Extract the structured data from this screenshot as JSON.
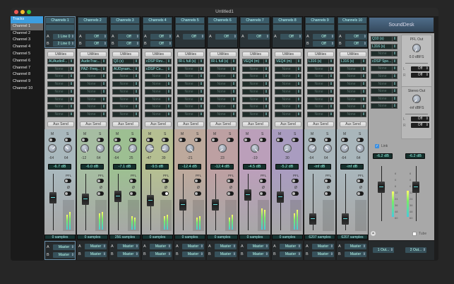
{
  "window": {
    "title": "Untitled1"
  },
  "sidebar": {
    "items": [
      "Tracks",
      "Channel 1",
      "Channel 2",
      "Channel 3",
      "Channel 4",
      "Channel 5",
      "Channel 6",
      "Channel 7",
      "Channel 8",
      "Channel 9",
      "Channel 10"
    ]
  },
  "labels": {
    "utilities": "Utilities",
    "aux_send": "Aux Send",
    "mute": "M",
    "solo": "S",
    "pfl": "PFL",
    "phase": "Ø",
    "a": "A",
    "b": "B"
  },
  "channels": [
    {
      "name": "Channels 1",
      "a": "1 Line 0",
      "b": "2 Line 0",
      "plugins": [
        "AUAudioF...",
        "None",
        "None",
        "None",
        "None",
        "None",
        "None",
        "None"
      ],
      "pan": [
        "-64",
        "64"
      ],
      "db": "-6.7 dB",
      "samples": "0 samples",
      "out_a": "Master",
      "out_b": "Master",
      "tint": "#a9b8bd",
      "fader": 0.6,
      "meter": [
        0.55,
        0.65
      ],
      "phase_on": false
    },
    {
      "name": "Channels 2",
      "a": "Off",
      "b": "Off",
      "plugins": [
        "AudioTrac...",
        "PAZ- Freq...",
        "None",
        "None",
        "None",
        "None",
        "None",
        "None"
      ],
      "pan": [
        "-12",
        "64"
      ],
      "db": "-6.0 dB",
      "samples": "0 samples",
      "out_a": "Master",
      "out_b": "Master",
      "tint": "#a6bda2",
      "fader": 0.58,
      "meter": [
        0.6,
        0.65
      ],
      "phase_on": false
    },
    {
      "name": "Channels 3",
      "a": "Off",
      "b": "Off",
      "plugins": [
        "Q3 (s)",
        "AUDynam...",
        "None",
        "None",
        "None",
        "None",
        "None",
        "None"
      ],
      "pan": [
        "-64",
        "25"
      ],
      "db": "-7.1 dB",
      "samples": "256 samples",
      "out_a": "Master",
      "out_b": "Master",
      "tint": "#9dbf92",
      "fader": 0.63,
      "meter": [
        0.5,
        0.45
      ],
      "phase_on": false
    },
    {
      "name": "Channels 4",
      "a": "Off",
      "b": "Off",
      "plugins": [
        "cDSP Rev...",
        "cDSP Co...",
        "None",
        "None",
        "None",
        "None",
        "None",
        "None"
      ],
      "pan": [
        "-47",
        "39"
      ],
      "db": "-9.5 dB",
      "samples": "0 samples",
      "out_a": "Master",
      "out_b": "Master",
      "tint": "#b5bf92",
      "fader": 0.55,
      "meter": [
        0.5,
        0.55
      ],
      "phase_on": true
    },
    {
      "name": "Channels 5",
      "a": "Off",
      "b": null,
      "plugins": [
        "IR-L full (s)",
        "None",
        "None",
        "None",
        "None",
        "None",
        "None",
        "None"
      ],
      "pan": [
        "-21"
      ],
      "db": "-12.4 dB",
      "samples": "0 samples",
      "out_a": "Master",
      "out_b": "Master",
      "tint": "#bda99c",
      "fader": 0.45,
      "meter": [
        0.45,
        0.5
      ],
      "phase_on": false
    },
    {
      "name": "Channels 6",
      "a": "Off",
      "b": null,
      "plugins": [
        "IR-L full (s)",
        "None",
        "None",
        "None",
        "None",
        "None",
        "None",
        "None"
      ],
      "pan": [
        "23"
      ],
      "db": "-12.4 dB",
      "samples": "0 samples",
      "out_a": "Master",
      "out_b": "Master",
      "tint": "#bda0a2",
      "fader": 0.45,
      "meter": [
        0.45,
        0.55
      ],
      "phase_on": false
    },
    {
      "name": "Channels 7",
      "a": "Off",
      "b": null,
      "plugins": [
        "VEQ4 (m)",
        "None",
        "None",
        "None",
        "None",
        "None",
        "None",
        "None"
      ],
      "pan": [
        "-19"
      ],
      "db": "-4.5 dB",
      "samples": "0 samples",
      "out_a": "Master",
      "out_b": "Master",
      "tint": "#bb9fba",
      "fader": 0.66,
      "meter": [
        0.8,
        0.75
      ],
      "phase_on": false
    },
    {
      "name": "Channels 8",
      "a": "Off",
      "b": null,
      "plugins": [
        "VEQ4 (m)",
        "None",
        "None",
        "None",
        "None",
        "None",
        "None",
        "None"
      ],
      "pan": [
        "30"
      ],
      "db": "-5.2 dB",
      "samples": "0 samples",
      "out_a": "Master",
      "out_b": "Master",
      "tint": "#a99cc0",
      "fader": 0.62,
      "meter": [
        0.6,
        0.75
      ],
      "phase_on": false
    },
    {
      "name": "Channels 9",
      "a": "Off",
      "b": "Off",
      "plugins": [
        "L316 (s)",
        "None",
        "None",
        "None",
        "None",
        "None",
        "None",
        "None"
      ],
      "pan": [
        "-64",
        "64"
      ],
      "db": "-inf dB",
      "samples": "6207 samples",
      "out_a": "Master",
      "out_b": "Master",
      "tint": "#a9b6bb",
      "fader": 0.15,
      "meter": [
        0,
        0
      ],
      "phase_on": false
    },
    {
      "name": "Channels 10",
      "a": "Off",
      "b": "Off",
      "plugins": [
        "L316 (s)",
        "None",
        "None",
        "None",
        "None",
        "None",
        "None",
        "None"
      ],
      "pan": [
        "-64",
        "64"
      ],
      "db": "-inf dB",
      "samples": "6207 samples",
      "out_a": "Master",
      "out_b": "Master",
      "tint": "#a9b6bb",
      "fader": 0.15,
      "meter": [
        0,
        0
      ],
      "phase_on": false
    }
  ],
  "master": {
    "title": "SoundDesk",
    "plugins": [
      "Q10 (s)",
      "L316 (s)",
      "None",
      "cDSP Spe...",
      "None",
      "None",
      "None",
      "None",
      "None",
      "None"
    ],
    "pfl_label": "PFL Out",
    "pfl_level": "0.0 dBFS",
    "pfl_l": "Off",
    "pfl_r": "Off",
    "stereo_label": "Stereo Out",
    "stereo_level": "-inf dBFS",
    "stereo_l": "Off",
    "stereo_r": "Off",
    "l": "L",
    "r": "R",
    "link_label": "Link",
    "link_checked": true,
    "db_left": "-6.2 dB",
    "db_right": "-6.2 dB",
    "scale": [
      "6",
      "0",
      "6",
      "12",
      "24",
      "36",
      "48",
      "60"
    ],
    "meter": [
      0.6,
      0.62
    ],
    "fader": 0.6,
    "tube_label": "Tube",
    "tube_checked": false,
    "out1": "1 Out...",
    "out2": "2 Out..."
  }
}
